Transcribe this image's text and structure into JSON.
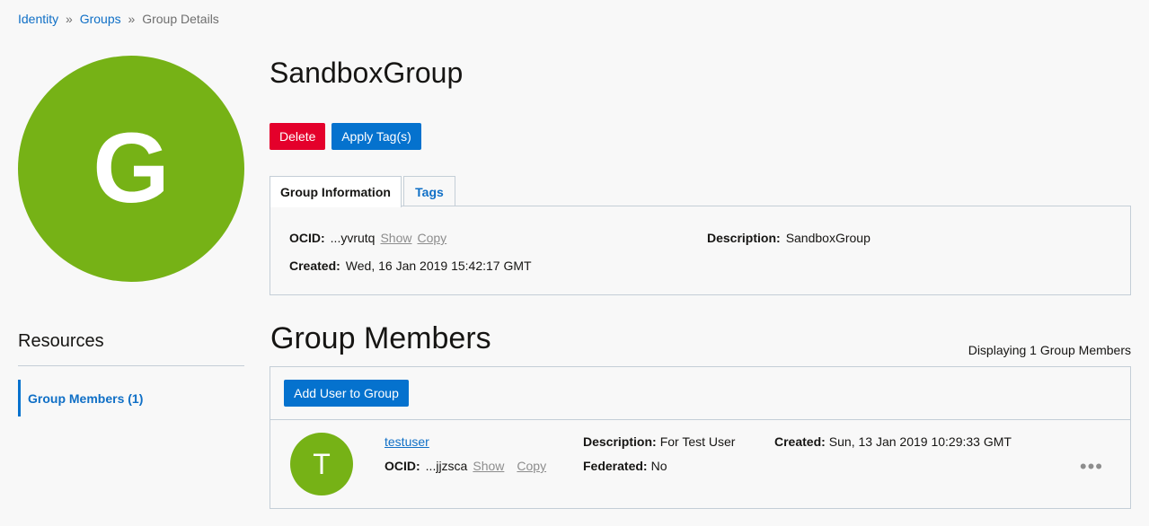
{
  "breadcrumb": {
    "identity": "Identity",
    "groups": "Groups",
    "current": "Group Details",
    "sep1": "»",
    "sep2": "»"
  },
  "avatar_letter": "G",
  "title": "SandboxGroup",
  "actions": {
    "delete": "Delete",
    "apply_tags": "Apply Tag(s)"
  },
  "tabs": [
    {
      "label": "Group Information"
    },
    {
      "label": "Tags"
    }
  ],
  "info": {
    "ocid_label": "OCID:",
    "ocid_value": "...yvrutq",
    "show": "Show",
    "copy": "Copy",
    "created_label": "Created:",
    "created_value": "Wed, 16 Jan 2019 15:42:17 GMT",
    "description_label": "Description:",
    "description_value": "SandboxGroup"
  },
  "resources": {
    "title": "Resources",
    "items": [
      {
        "label": "Group Members (1)"
      }
    ]
  },
  "members": {
    "title": "Group Members",
    "count": "Displaying 1 Group Members",
    "add_button": "Add User to Group",
    "rows": [
      {
        "avatar_letter": "T",
        "name": "testuser",
        "ocid_label": "OCID:",
        "ocid_value": "...jjzsca",
        "show": "Show",
        "copy": "Copy",
        "description_label": "Description:",
        "description_value": "For Test User",
        "federated_label": "Federated:",
        "federated_value": "No",
        "created_label": "Created:",
        "created_value": "Sun, 13 Jan 2019 10:29:33 GMT",
        "more": "•••"
      }
    ]
  },
  "colors": {
    "accent_green": "#76b216",
    "primary_blue": "#0572ce",
    "danger_red": "#e4002b"
  }
}
